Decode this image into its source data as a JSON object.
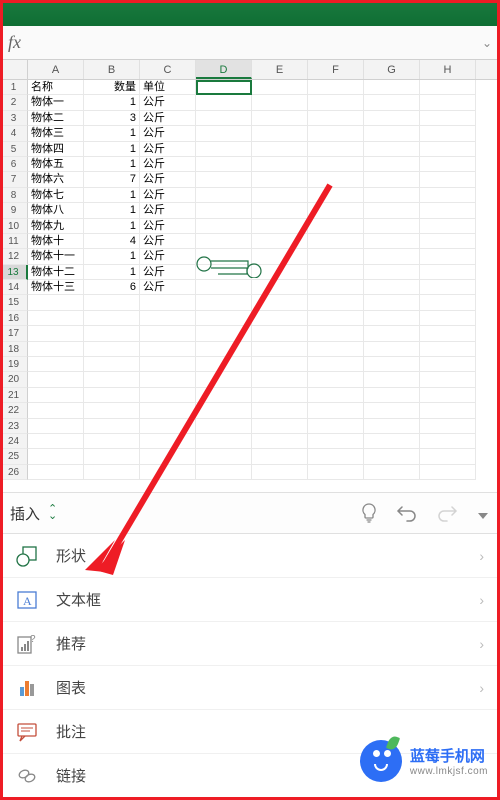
{
  "formula_bar": {
    "fx": "fx",
    "value": ""
  },
  "columns": [
    "A",
    "B",
    "C",
    "D",
    "E",
    "F",
    "G",
    "H"
  ],
  "selected_column": "D",
  "selected_row": 13,
  "headers": {
    "name": "名称",
    "qty": "数量",
    "unit": "单位"
  },
  "rows": [
    {
      "n": "物体一",
      "q": 1,
      "u": "公斤"
    },
    {
      "n": "物体二",
      "q": 3,
      "u": "公斤"
    },
    {
      "n": "物体三",
      "q": 1,
      "u": "公斤"
    },
    {
      "n": "物体四",
      "q": 1,
      "u": "公斤"
    },
    {
      "n": "物体五",
      "q": 1,
      "u": "公斤"
    },
    {
      "n": "物体六",
      "q": 7,
      "u": "公斤"
    },
    {
      "n": "物体七",
      "q": 1,
      "u": "公斤"
    },
    {
      "n": "物体八",
      "q": 1,
      "u": "公斤"
    },
    {
      "n": "物体九",
      "q": 1,
      "u": "公斤"
    },
    {
      "n": "物体十",
      "q": 4,
      "u": "公斤"
    },
    {
      "n": "物体十一",
      "q": 1,
      "u": "公斤"
    },
    {
      "n": "物体十二",
      "q": 1,
      "u": "公斤"
    },
    {
      "n": "物体十三",
      "q": 6,
      "u": "公斤"
    }
  ],
  "empty_rows": [
    15,
    16,
    17,
    18,
    19,
    20,
    21,
    22,
    23,
    24,
    25,
    26
  ],
  "toolbar": {
    "dropdown_label": "插入"
  },
  "menu": {
    "shape": "形状",
    "textbox": "文本框",
    "recommend": "推荐",
    "chart": "图表",
    "comment": "批注",
    "link": "链接"
  },
  "watermark": {
    "top": "蓝莓手机网",
    "bottom": "www.lmkjsf.com"
  },
  "icon_colors": {
    "accent": "#217346",
    "col_blue": "#5b9bd5",
    "col_orange": "#ed7d31"
  }
}
